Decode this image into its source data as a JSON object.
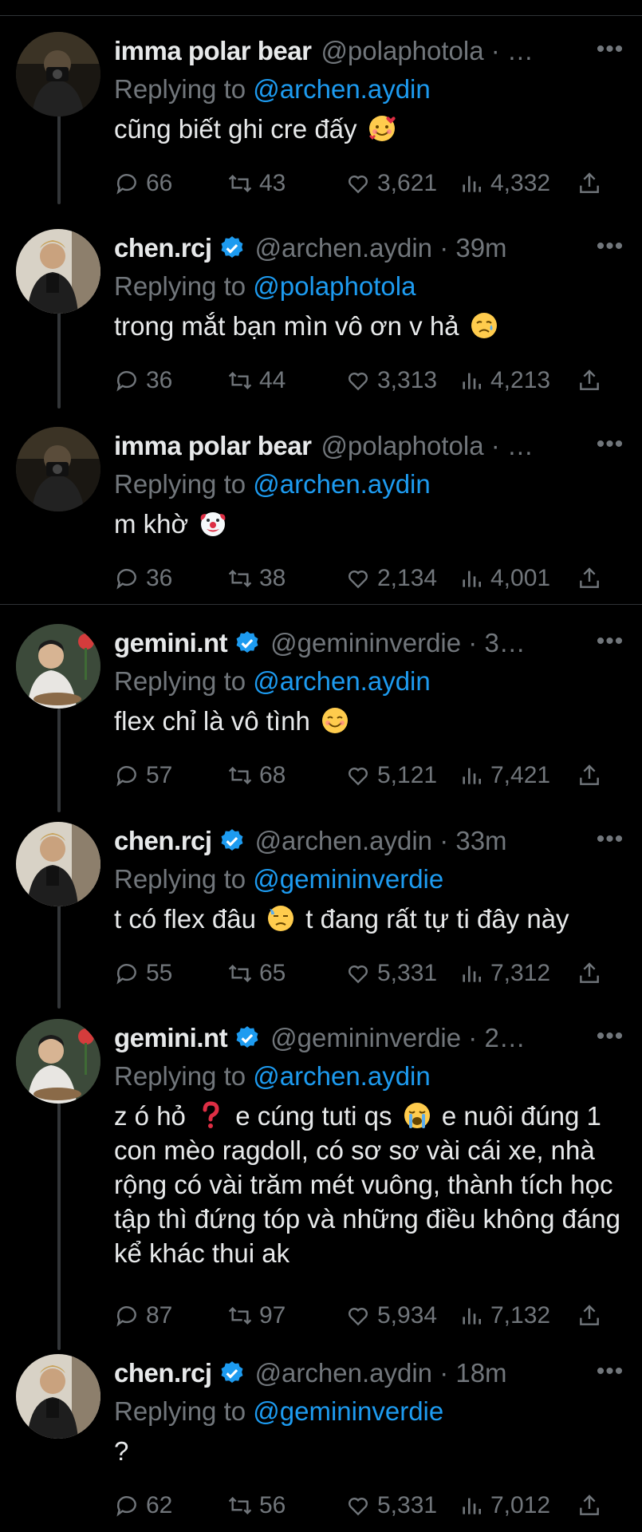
{
  "ui": {
    "more_label": "•••",
    "replying_prefix": "Replying to",
    "colors": {
      "background": "#000000",
      "text": "#e7e9ea",
      "muted": "#71767b",
      "accent": "#1d9bf0",
      "divider": "#2f3336"
    }
  },
  "tweets": [
    {
      "name": "imma polar bear",
      "verified": false,
      "handle_time": "@polaphotola · …",
      "reply_to": "@archen.aydin",
      "text_before": "cũng biết ghi cre đấy ",
      "emoji": "smiling-face-with-hearts",
      "text_after": "",
      "replies": "66",
      "retweets": "43",
      "likes": "3,621",
      "views": "4,332"
    },
    {
      "name": "chen.rcj",
      "verified": true,
      "handle_time": "@archen.aydin · 39m",
      "reply_to": "@polaphotola",
      "text_before": "trong mắt bạn mìn vô ơn v hả ",
      "emoji": "sad-but-relieved-face",
      "text_after": "",
      "replies": "36",
      "retweets": "44",
      "likes": "3,313",
      "views": "4,213"
    },
    {
      "name": "imma polar bear",
      "verified": false,
      "handle_time": "@polaphotola · …",
      "reply_to": "@archen.aydin",
      "text_before": "m khờ ",
      "emoji": "clown-face",
      "text_after": "",
      "replies": "36",
      "retweets": "38",
      "likes": "2,134",
      "views": "4,001"
    },
    {
      "name": "gemini.nt",
      "verified": true,
      "handle_time": "@gemininverdie · 3…",
      "reply_to": "@archen.aydin",
      "text_before": "flex chỉ là vô tình ",
      "emoji": "smiling-face",
      "text_after": "",
      "replies": "57",
      "retweets": "68",
      "likes": "5,121",
      "views": "7,421"
    },
    {
      "name": "chen.rcj",
      "verified": true,
      "handle_time": "@archen.aydin · 33m",
      "reply_to": "@gemininverdie",
      "text_before": "t có flex đâu ",
      "emoji": "downcast-face-with-sweat",
      "text_after": " t đang rất tự ti đây này",
      "replies": "55",
      "retweets": "65",
      "likes": "5,331",
      "views": "7,312"
    },
    {
      "name": "gemini.nt",
      "verified": true,
      "handle_time": "@gemininverdie · 2…",
      "reply_to": "@archen.aydin",
      "text_before": "z ó hỏ ",
      "emoji": "red-question-mark",
      "text_mid": " e cúng tuti qs ",
      "emoji2": "loudly-crying-face",
      "text_after": " e nuôi đúng 1 con mèo ragdoll, có sơ sơ vài cái xe, nhà rộng có vài trăm mét vuông, thành tích học tập thì đứng tóp và những điều không đáng kể khác thui ak",
      "replies": "87",
      "retweets": "97",
      "likes": "5,934",
      "views": "7,132"
    },
    {
      "name": "chen.rcj",
      "verified": true,
      "handle_time": "@archen.aydin · 18m",
      "reply_to": "@gemininverdie",
      "text_before": "?",
      "emoji": "",
      "text_after": "",
      "replies": "62",
      "retweets": "56",
      "likes": "5,331",
      "views": "7,012"
    }
  ]
}
